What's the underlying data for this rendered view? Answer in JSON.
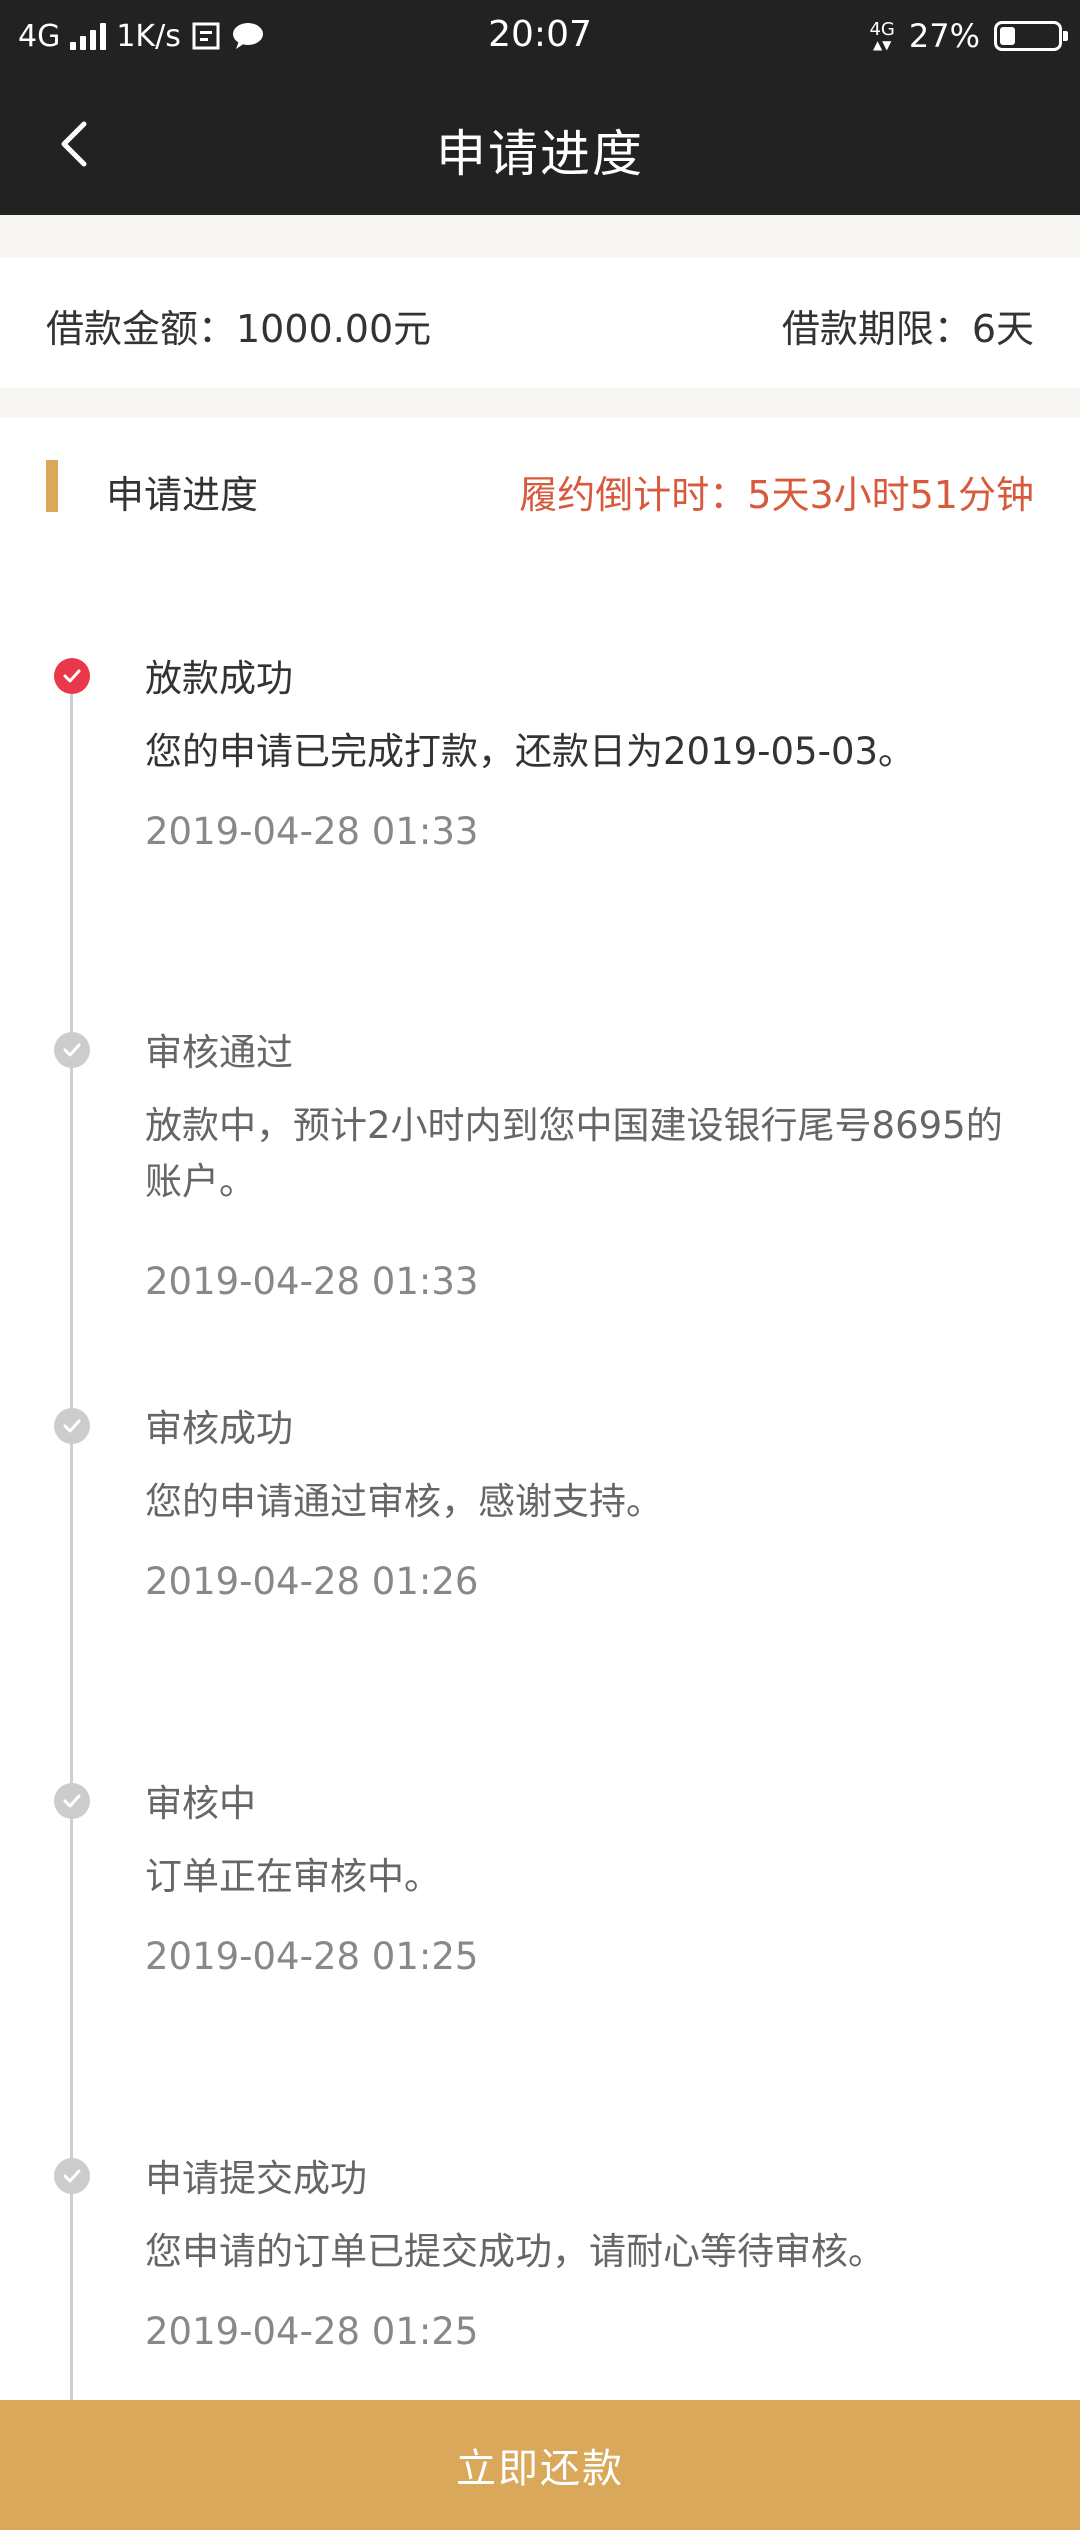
{
  "status_bar": {
    "network": "4G",
    "speed": "1K/s",
    "time": "20:07",
    "mini_network": "4G",
    "battery": "27%",
    "battery_level": 0.27
  },
  "nav": {
    "title": "申请进度"
  },
  "loan": {
    "amount": "借款金额：1000.00元",
    "term": "借款期限：6天"
  },
  "progress": {
    "title": "申请进度",
    "countdown": "履约倒计时：5天3小时51分钟"
  },
  "timeline": [
    {
      "title": "放款成功",
      "desc": "您的申请已完成打款，还款日为2019-05-03。",
      "time": "2019-04-28 01:33",
      "active": true
    },
    {
      "title": "审核通过",
      "desc": "放款中，预计2小时内到您中国建设银行尾号8695的账户。",
      "time": "2019-04-28 01:33",
      "active": false
    },
    {
      "title": "审核成功",
      "desc": "您的申请通过审核，感谢支持。",
      "time": "2019-04-28 01:26",
      "active": false
    },
    {
      "title": "审核中",
      "desc": "订单正在审核中。",
      "time": "2019-04-28 01:25",
      "active": false
    },
    {
      "title": "申请提交成功",
      "desc": "您申请的订单已提交成功，请耐心等待审核。",
      "time": "2019-04-28 01:25",
      "active": false
    }
  ],
  "action": {
    "repay_label": "立即还款"
  },
  "colors": {
    "header_bg": "#222222",
    "accent": "#d9a85b",
    "countdown": "#d85a3c",
    "active_dot": "#e8384a"
  }
}
